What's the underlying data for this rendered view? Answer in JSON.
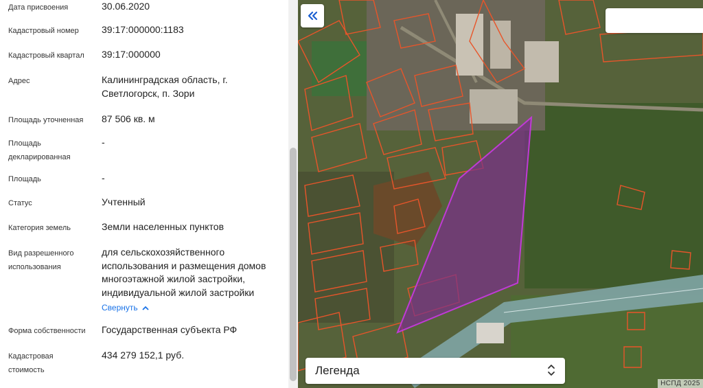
{
  "fields": [
    {
      "label": "Дата присвоения",
      "value": "30.06.2020"
    },
    {
      "label": "Кадастровый номер",
      "value": "39:17:000000:1183"
    },
    {
      "label": "Кадастровый квартал",
      "value": "39:17:000000"
    },
    {
      "label": "Адрес",
      "value": "Калининградская область, г. Светлогорск, п. Зори"
    },
    {
      "label": "Площадь уточненная",
      "value": "87 506 кв. м"
    },
    {
      "label": "Площадь декларированная",
      "value": "-"
    },
    {
      "label": "Площадь",
      "value": "-"
    },
    {
      "label": "Статус",
      "value": "Учтенный"
    },
    {
      "label": "Категория земель",
      "value": "Земли населенных пунктов"
    },
    {
      "label": "Вид разрешенного использования",
      "value": "для сельскохозяйственного использования и размещения домов многоэтажной жилой застройки, индивидуальной жилой застройки"
    },
    {
      "label": "Форма собственности",
      "value": "Государственная субъекта РФ"
    },
    {
      "label": "Кадастровая стоимость",
      "value": "434 279 152,1 руб."
    }
  ],
  "collapse_link": "Свернуть",
  "map": {
    "search_placeholder": "",
    "legend_label": "Легенда",
    "attribution": "НСПД 2025",
    "colors": {
      "parcel": "#e8552a",
      "selected_fill": "#7a2f8a",
      "selected_stroke": "#c03ad6",
      "road": "#7fa5a5"
    },
    "icons": {
      "collapse": "double-chevron-left-icon",
      "legend_sort": "up-down-chevron-icon"
    }
  }
}
